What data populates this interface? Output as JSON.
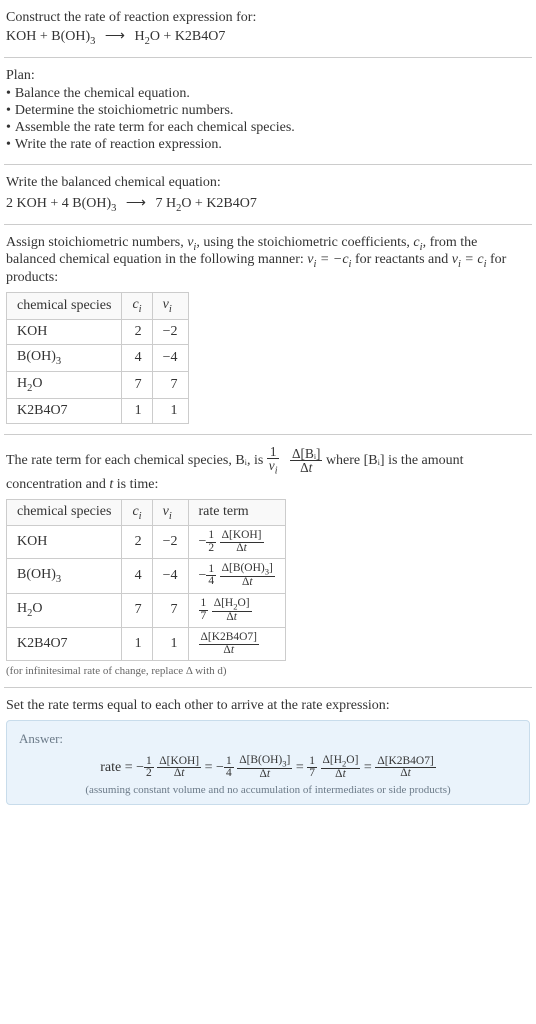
{
  "prompt": {
    "line1": "Construct the rate of reaction expression for:",
    "equation_lhs": "KOH + B(OH)₃",
    "arrow": "⟶",
    "equation_rhs": "H₂O + K2B4O7"
  },
  "plan": {
    "heading": "Plan:",
    "items": [
      "Balance the chemical equation.",
      "Determine the stoichiometric numbers.",
      "Assemble the rate term for each chemical species.",
      "Write the rate of reaction expression."
    ],
    "bullet": "•"
  },
  "balanced": {
    "intro": "Write the balanced chemical equation:",
    "lhs": "2 KOH + 4 B(OH)₃",
    "arrow": "⟶",
    "rhs": "7 H₂O + K2B4O7"
  },
  "stoich_intro": {
    "text_a": "Assign stoichiometric numbers, ",
    "nu": "ν",
    "sub_i": "i",
    "text_b": ", using the stoichiometric coefficients, ",
    "c": "c",
    "text_c": ", from the balanced chemical equation in the following manner: ",
    "rel_reactant": "νᵢ = −cᵢ",
    "text_d": " for reactants and ",
    "rel_product": "νᵢ = cᵢ",
    "text_e": " for products:"
  },
  "stoich_table": {
    "headers": {
      "species": "chemical species",
      "c": "cᵢ",
      "nu": "νᵢ"
    },
    "rows": [
      {
        "species": "KOH",
        "c": "2",
        "nu": "−2"
      },
      {
        "species": "B(OH)₃",
        "c": "4",
        "nu": "−4"
      },
      {
        "species": "H₂O",
        "c": "7",
        "nu": "7"
      },
      {
        "species": "K2B4O7",
        "c": "1",
        "nu": "1"
      }
    ]
  },
  "rate_term_intro": {
    "a": "The rate term for each chemical species, Bᵢ, is ",
    "frac1_num": "1",
    "frac1_den": "νᵢ",
    "frac2_num": "Δ[Bᵢ]",
    "frac2_den": "Δt",
    "b": " where [Bᵢ] is the amount concentration and ",
    "t": "t",
    "c": " is time:"
  },
  "rate_table": {
    "headers": {
      "species": "chemical species",
      "c": "cᵢ",
      "nu": "νᵢ",
      "term": "rate term"
    },
    "rows": [
      {
        "species": "KOH",
        "c": "2",
        "nu": "−2",
        "sign": "−",
        "coef_num": "1",
        "coef_den": "2",
        "d_num": "Δ[KOH]",
        "d_den": "Δt"
      },
      {
        "species": "B(OH)₃",
        "c": "4",
        "nu": "−4",
        "sign": "−",
        "coef_num": "1",
        "coef_den": "4",
        "d_num": "Δ[B(OH)₃]",
        "d_den": "Δt"
      },
      {
        "species": "H₂O",
        "c": "7",
        "nu": "7",
        "sign": "",
        "coef_num": "1",
        "coef_den": "7",
        "d_num": "Δ[H₂O]",
        "d_den": "Δt"
      },
      {
        "species": "K2B4O7",
        "c": "1",
        "nu": "1",
        "sign": "",
        "coef_num": "",
        "coef_den": "",
        "d_num": "Δ[K2B4O7]",
        "d_den": "Δt"
      }
    ],
    "note": "(for infinitesimal rate of change, replace Δ with d)"
  },
  "final_intro": "Set the rate terms equal to each other to arrive at the rate expression:",
  "answer": {
    "label": "Answer:",
    "rate_label": "rate = ",
    "terms": [
      {
        "sign": "−",
        "coef_num": "1",
        "coef_den": "2",
        "d_num": "Δ[KOH]",
        "d_den": "Δt"
      },
      {
        "sign": "−",
        "coef_num": "1",
        "coef_den": "4",
        "d_num": "Δ[B(OH)₃]",
        "d_den": "Δt"
      },
      {
        "sign": "",
        "coef_num": "1",
        "coef_den": "7",
        "d_num": "Δ[H₂O]",
        "d_den": "Δt"
      },
      {
        "sign": "",
        "coef_num": "",
        "coef_den": "",
        "d_num": "Δ[K2B4O7]",
        "d_den": "Δt"
      }
    ],
    "eq": " = ",
    "note": "(assuming constant volume and no accumulation of intermediates or side products)"
  }
}
